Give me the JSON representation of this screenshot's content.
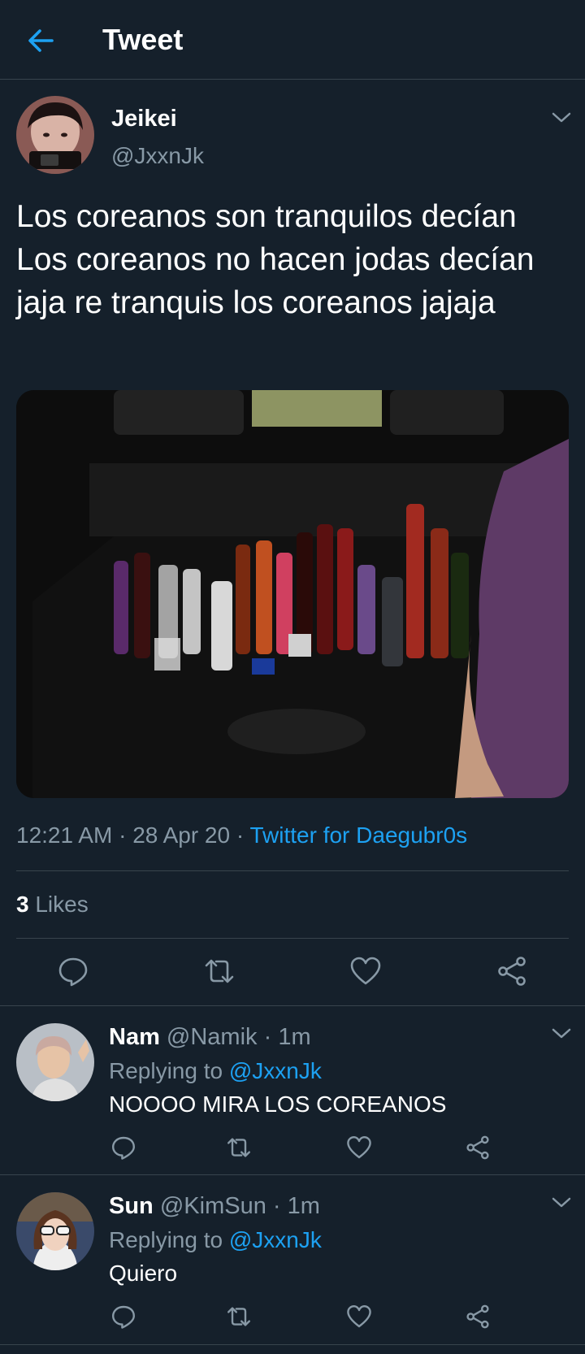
{
  "header": {
    "title": "Tweet"
  },
  "tweet": {
    "author_name": "Jeikei",
    "author_handle": "@JxxnJk",
    "text": "Los coreanos son tranquilos decían\nLos coreanos no hacen jodas decían\njaja re tranquis los coreanos jajaja",
    "time": "12:21 AM",
    "date": "28 Apr 20",
    "source": "Twitter for Daegubr0s",
    "likes_count": "3",
    "likes_label": "Likes"
  },
  "replies": [
    {
      "name": "Nam",
      "handle": "@Namik",
      "age": "1m",
      "replying_prefix": "Replying to",
      "replying_to": "@JxxnJk",
      "text": "NOOOO MIRA LOS COREANOS"
    },
    {
      "name": "Sun",
      "handle": "@KimSun",
      "age": "1m",
      "replying_prefix": "Replying to",
      "replying_to": "@JxxnJk",
      "text": "Quiero"
    }
  ],
  "icons": [
    "back-arrow-icon",
    "chevron-down-icon",
    "reply-icon",
    "retweet-icon",
    "like-icon",
    "share-icon"
  ],
  "colors": {
    "background": "#15202b",
    "accent": "#1da1f2",
    "secondary_text": "#8899a6",
    "divider": "#38444d"
  }
}
